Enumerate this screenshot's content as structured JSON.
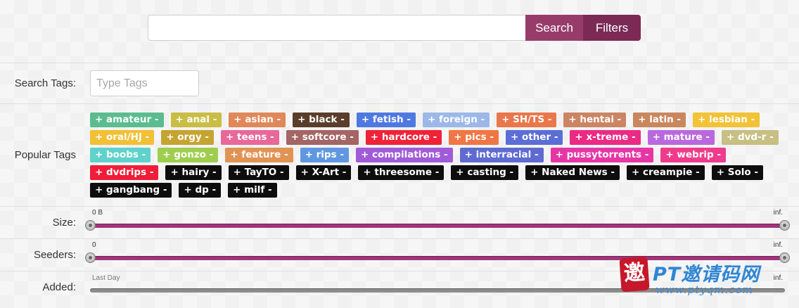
{
  "search": {
    "value": "",
    "placeholder": "",
    "search_label": "Search",
    "filters_label": "Filters"
  },
  "search_tags": {
    "label": "Search Tags:",
    "placeholder": "Type Tags"
  },
  "popular_tags": {
    "label": "Popular Tags",
    "plus": "+",
    "minus": "-",
    "rows": [
      [
        {
          "name": "amateur",
          "color": "#5bbd8f"
        },
        {
          "name": "anal",
          "color": "#c9bd45"
        },
        {
          "name": "asian",
          "color": "#e0885a"
        },
        {
          "name": "black",
          "color": "#5a3d2b"
        },
        {
          "name": "fetish",
          "color": "#4f79e0"
        },
        {
          "name": "foreign",
          "color": "#9cb8e8"
        },
        {
          "name": "SH/TS",
          "color": "#e9774b"
        },
        {
          "name": "hentai",
          "color": "#cc8564"
        },
        {
          "name": "latin",
          "color": "#c9875e"
        },
        {
          "name": "lesbian",
          "color": "#f2c237"
        }
      ],
      [
        {
          "name": "oral/HJ",
          "color": "#f1c035"
        },
        {
          "name": "orgy",
          "color": "#c5a432"
        },
        {
          "name": "teens",
          "color": "#e8689a"
        },
        {
          "name": "softcore",
          "color": "#a46565"
        },
        {
          "name": "hardcore",
          "color": "#ef2238"
        },
        {
          "name": "pics",
          "color": "#f07645"
        },
        {
          "name": "other",
          "color": "#5b6ed6"
        },
        {
          "name": "x-treme",
          "color": "#ea2a85"
        },
        {
          "name": "mature",
          "color": "#b969dd"
        },
        {
          "name": "dvd-r",
          "color": "#c7bf83"
        }
      ],
      [
        {
          "name": "boobs",
          "color": "#5ed2cb"
        },
        {
          "name": "gonzo",
          "color": "#9fce4e"
        },
        {
          "name": "feature",
          "color": "#e19353"
        },
        {
          "name": "rips",
          "color": "#5f98e0"
        },
        {
          "name": "compilations",
          "color": "#a15ad8"
        },
        {
          "name": "interracial",
          "color": "#5f6bd1"
        },
        {
          "name": "pussytorrents",
          "color": "#e636a6"
        },
        {
          "name": "webrip",
          "color": "#ee3b8c"
        }
      ],
      [
        {
          "name": "dvdrips",
          "color": "#ee1d38"
        },
        {
          "name": "hairy",
          "color": "#0d0d0d"
        },
        {
          "name": "TayTO",
          "color": "#0d0d0d"
        },
        {
          "name": "X-Art",
          "color": "#0d0d0d"
        },
        {
          "name": "threesome",
          "color": "#0d0d0d"
        },
        {
          "name": "casting",
          "color": "#0d0d0d"
        },
        {
          "name": "Naked News",
          "color": "#0d0d0d"
        },
        {
          "name": "creampie",
          "color": "#0d0d0d"
        },
        {
          "name": "Solo",
          "color": "#0d0d0d"
        }
      ],
      [
        {
          "name": "gangbang",
          "color": "#0d0d0d"
        },
        {
          "name": "dp",
          "color": "#0d0d0d"
        },
        {
          "name": "milf",
          "color": "#0d0d0d"
        }
      ]
    ]
  },
  "size": {
    "label": "Size:",
    "min_label": "0 B",
    "max_label": "inf.",
    "range": [
      0,
      1
    ]
  },
  "seeders": {
    "label": "Seeders:",
    "min_label": "0",
    "max_label": "inf.",
    "range": [
      0,
      1
    ]
  },
  "added": {
    "label": "Added:",
    "min_label": "Last Day",
    "max_label": "inf."
  },
  "watermark": {
    "badge": "邀",
    "title": "PT邀请码网",
    "url": "www.ptyqm.com"
  },
  "colors": {
    "accent": "#973c6a",
    "accent_dark": "#7a2a54",
    "slider_track": "#a1357c"
  }
}
